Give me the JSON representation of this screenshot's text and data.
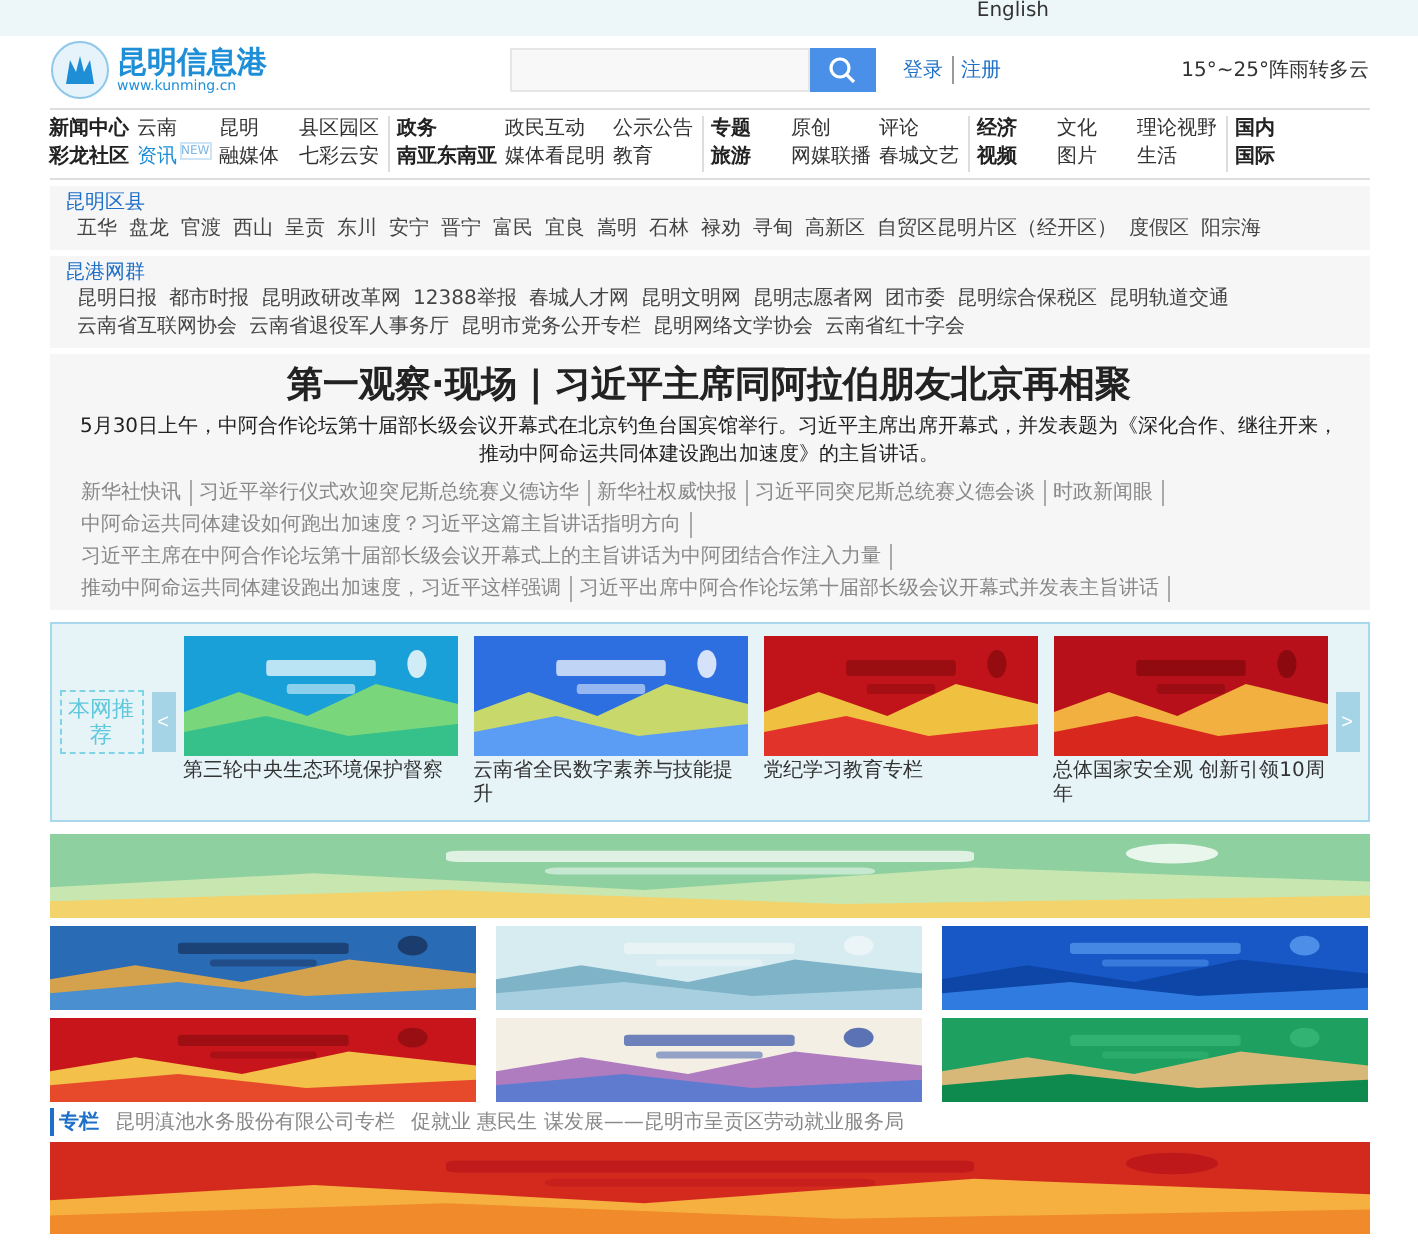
{
  "top_bar": {
    "links": [
      "English"
    ]
  },
  "header": {
    "logo_text": "昆明信息港",
    "logo_url": "www.kunming.cn",
    "login": "登录",
    "register": "注册",
    "weather": "15°~25°阵雨转多云"
  },
  "nav": {
    "groups": [
      {
        "columns": [
          [
            "新闻中心",
            "彩龙社区"
          ],
          [
            "云南",
            "资讯"
          ],
          [
            "昆明",
            "融媒体"
          ],
          [
            "县区园区",
            "七彩云安"
          ]
        ],
        "badge": "NEW"
      },
      {
        "columns": [
          [
            "政务",
            "南亚东南亚"
          ],
          [
            "政民互动",
            "媒体看昆明"
          ],
          [
            "公示公告",
            "教育"
          ]
        ]
      },
      {
        "columns": [
          [
            "专题",
            "旅游"
          ],
          [
            "原创",
            "网媒联播"
          ],
          [
            "评论",
            "春城文艺"
          ]
        ]
      },
      {
        "columns": [
          [
            "经济",
            "视频"
          ],
          [
            "文化",
            "图片"
          ],
          [
            "理论视野",
            "生活"
          ]
        ]
      },
      {
        "columns": [
          [
            "国内",
            "国际"
          ]
        ]
      }
    ]
  },
  "directory": [
    {
      "title": "昆明区县",
      "links": [
        "五华",
        "盘龙",
        "官渡",
        "西山",
        "呈贡",
        "东川",
        "安宁",
        "晋宁",
        "富民",
        "宜良",
        "嵩明",
        "石林",
        "禄劝",
        "寻甸",
        "高新区",
        "自贸区昆明片区（经开区）",
        "度假区",
        "阳宗海"
      ]
    },
    {
      "title": "昆港网群",
      "links": [
        "昆明日报",
        "都市时报",
        "昆明政研改革网",
        "12388举报",
        "春城人才网",
        "昆明文明网",
        "昆明志愿者网",
        "团市委",
        "昆明综合保税区",
        "昆明轨道交通",
        "云南省互联网协会",
        "云南省退役军人事务厅",
        "昆明市党务公开专栏",
        "昆明网络文学协会",
        "云南省红十字会"
      ]
    }
  ],
  "headline": {
    "title": "第一观察·现场 | 习近平主席同阿拉伯朋友北京再相聚",
    "summary": "5月30日上午，中阿合作论坛第十届部长级会议开幕式在北京钓鱼台国宾馆举行。习近平主席出席开幕式，并发表题为《深化合作、继往开来，推动中阿命运共同体建设跑出加速度》的主旨讲话。",
    "links": [
      "新华社快讯",
      "习近平举行仪式欢迎突尼斯总统赛义德访华",
      "新华社权威快报",
      "习近平同突尼斯总统赛义德会谈",
      "时政新闻眼",
      "中阿命运共同体建设如何跑出加速度？习近平这篇主旨讲话指明方向",
      "习近平主席在中阿合作论坛第十届部长级会议开幕式上的主旨讲话为中阿团结合作注入力量",
      "推动中阿命运共同体建设跑出加速度，习近平这样强调",
      "习近平出席中阿合作论坛第十届部长级会议开幕式并发表主旨讲话"
    ]
  },
  "recommend": {
    "label": "本网推荐",
    "prev": "<",
    "next": ">",
    "items": [
      {
        "caption": "第三轮中央生态环境保护督察",
        "kind": "picture"
      },
      {
        "caption": "云南省全民数字素养与技能提升",
        "kind": "picture"
      },
      {
        "caption": "党纪学习教育专栏",
        "kind": "picture"
      },
      {
        "caption": "总体国家安全观 创新引领10周年",
        "kind": "picture"
      }
    ]
  },
  "columns_bar": {
    "label": "专栏",
    "links": [
      "昆明滇池水务股份有限公司专栏",
      "促就业 惠民生 谋发展——昆明市呈贡区劳动就业服务局"
    ]
  }
}
